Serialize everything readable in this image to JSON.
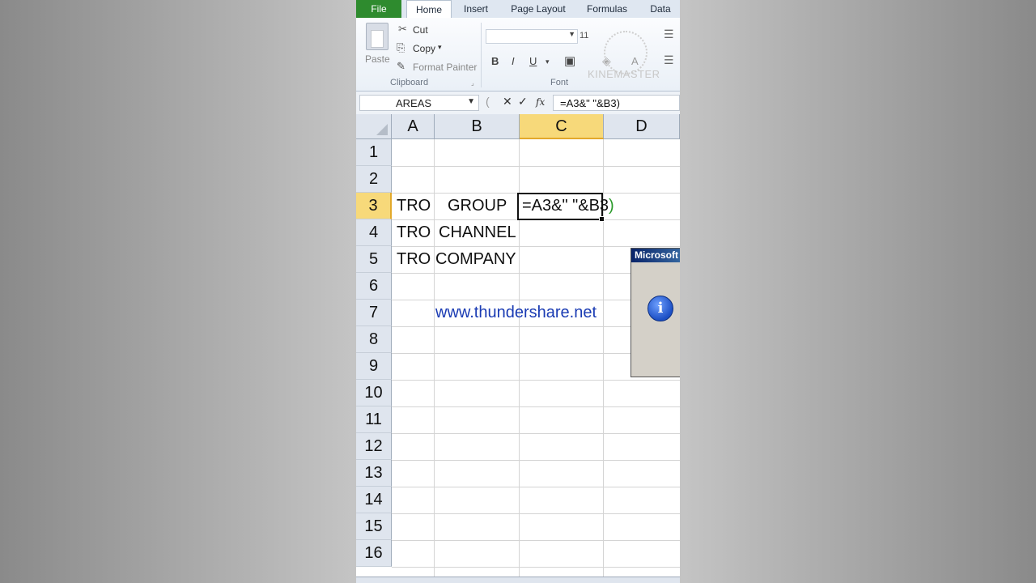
{
  "ribbon": {
    "tabs": [
      "File",
      "Home",
      "Insert",
      "Page Layout",
      "Formulas",
      "Data"
    ],
    "active_tab": "Home",
    "clipboard": {
      "paste": "Paste",
      "cut": "Cut",
      "copy": "Copy",
      "format_painter": "Format Painter",
      "group_label": "Clipboard"
    },
    "font": {
      "size": "11",
      "bold": "B",
      "italic": "I",
      "underline": "U",
      "group_label": "Font"
    },
    "watermark": "KINEMASTER"
  },
  "formula_bar": {
    "name_box": "AREAS",
    "fx": "fx",
    "formula": "=A3&\" \"&B3)"
  },
  "grid": {
    "columns": [
      "A",
      "B",
      "C",
      "D"
    ],
    "selected_column": "C",
    "rows": [
      "1",
      "2",
      "3",
      "4",
      "5",
      "6",
      "7",
      "8",
      "9",
      "10",
      "11",
      "12",
      "13",
      "14",
      "15",
      "16"
    ],
    "selected_row": "3",
    "cells": {
      "A3": "TRO",
      "B3": "GROUP",
      "A4": "TRO",
      "B4": "CHANNEL",
      "A5": "TRO",
      "B5": "COMPANY",
      "B7": "www.thundershare.net"
    },
    "active_cell": "C3",
    "edit_text_main": "=A3&\" \"&B3",
    "edit_text_paren": ")"
  },
  "dialog": {
    "title": "Microsoft",
    "icon": "info-icon"
  }
}
